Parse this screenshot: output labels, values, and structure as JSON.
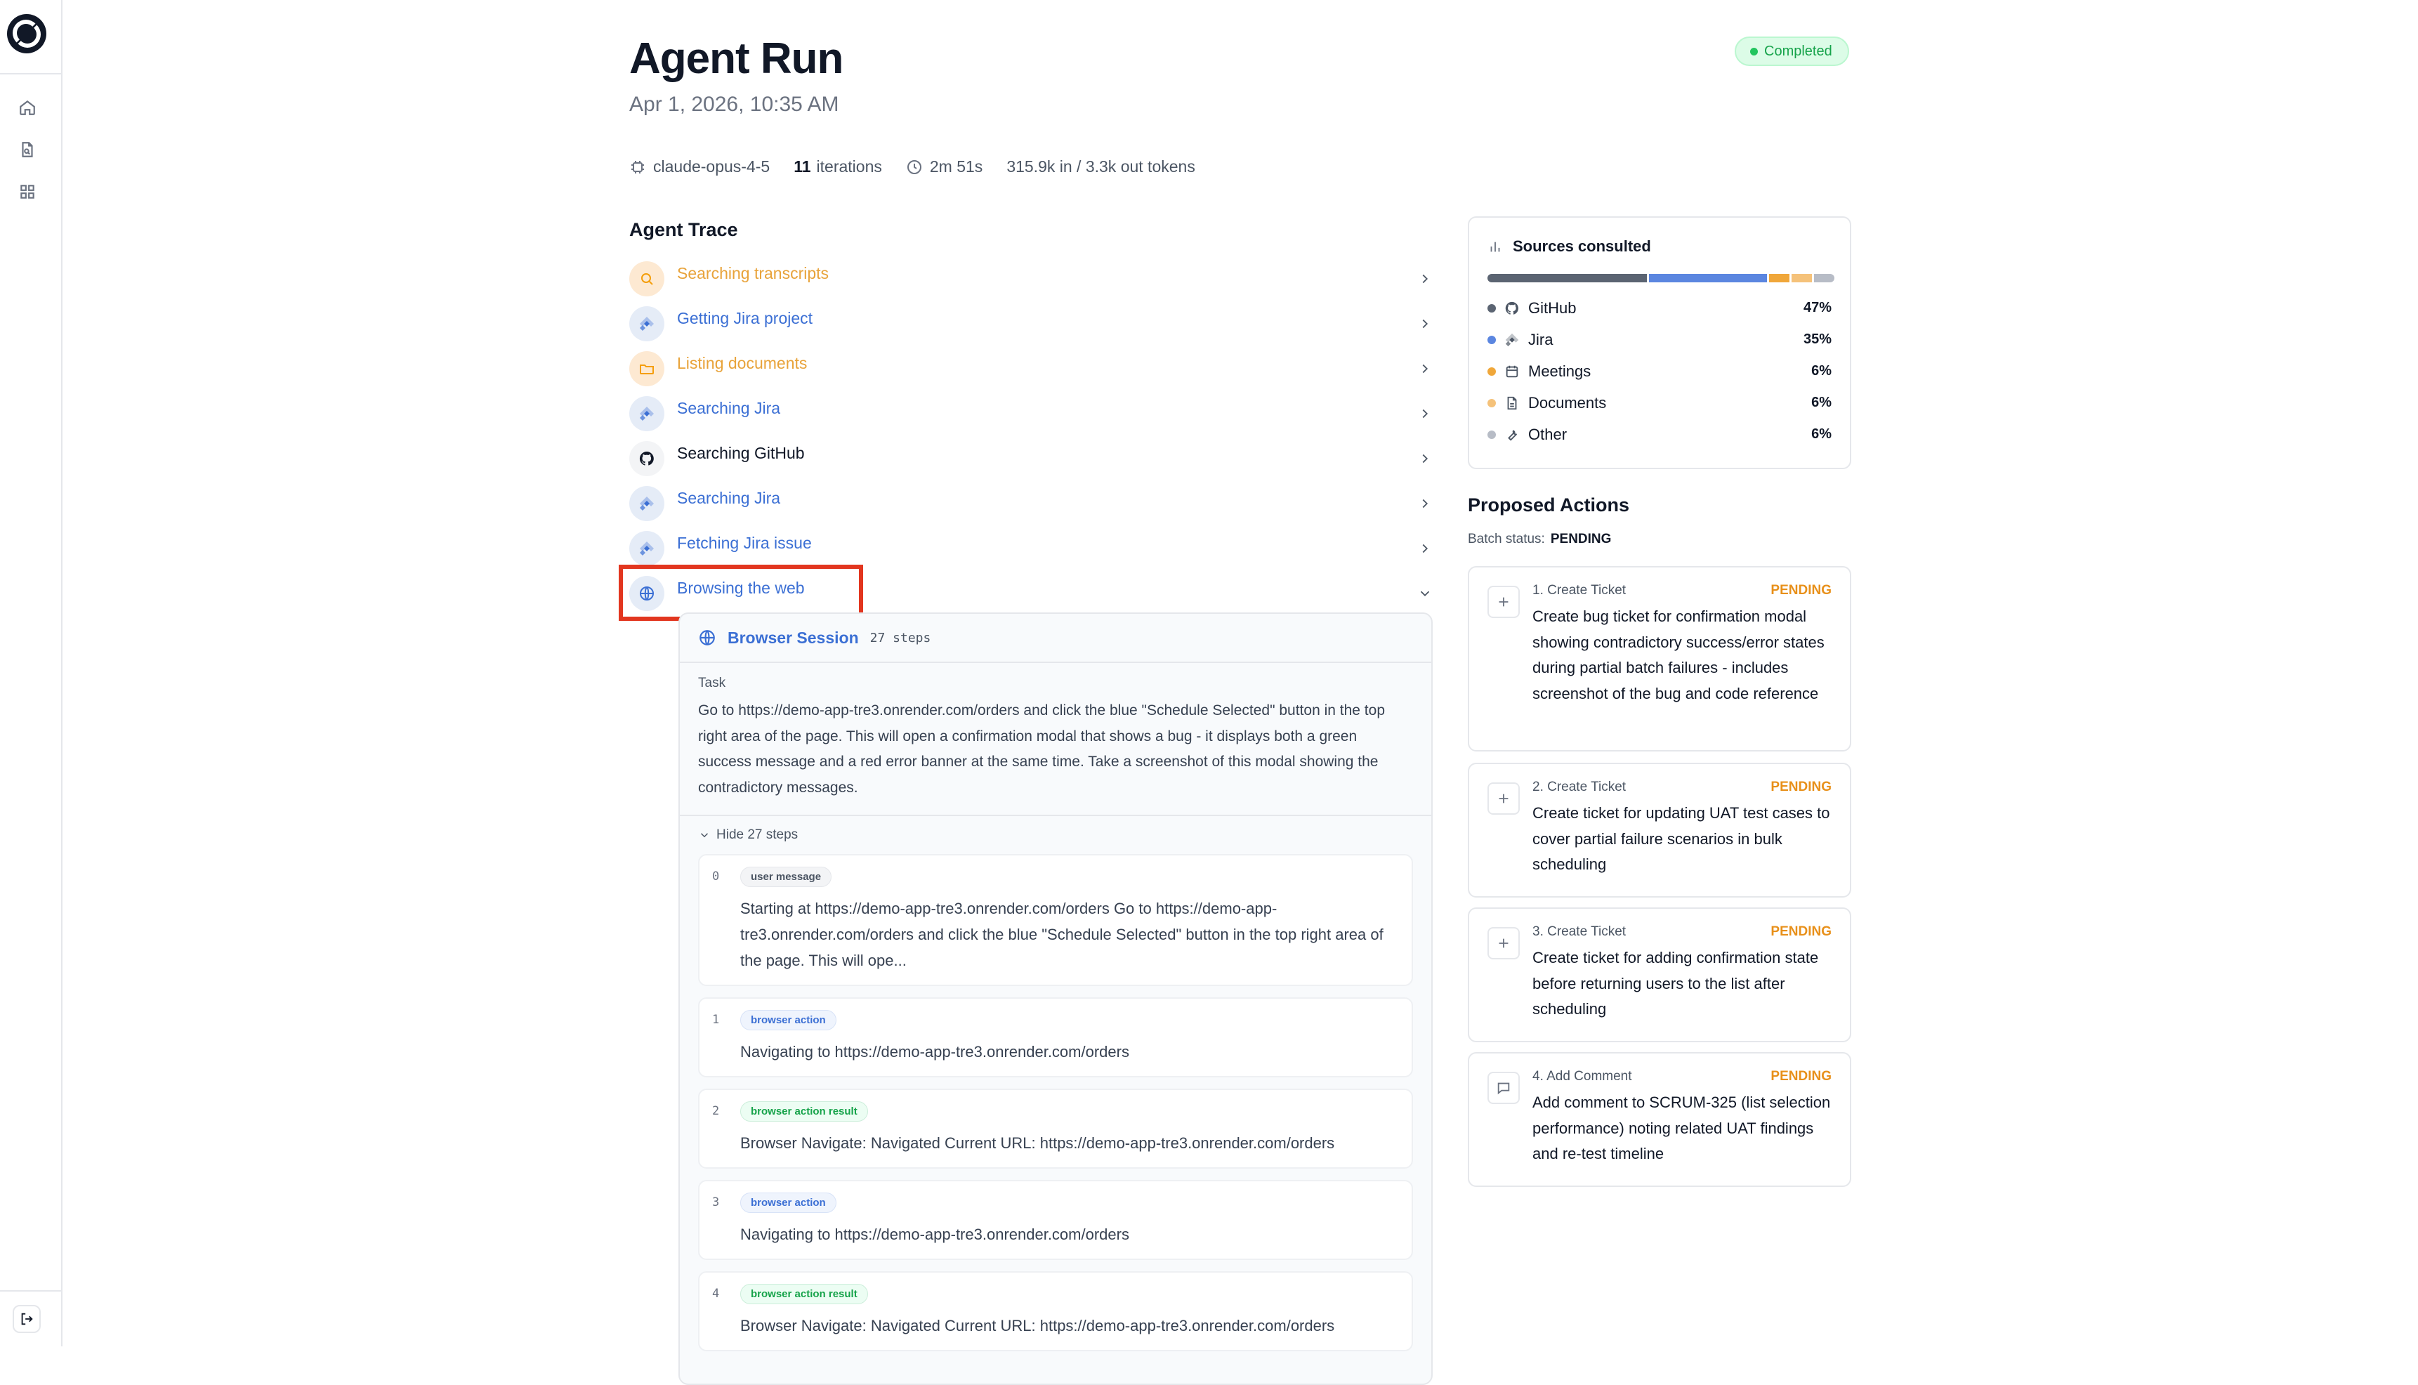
{
  "header": {
    "title": "Agent Run",
    "date": "Apr 1, 2026, 10:35 AM",
    "status_badge": "Completed"
  },
  "meta": {
    "model": "claude-opus-4-5",
    "iterations_count": "11",
    "iterations_label": "iterations",
    "duration": "2m 51s",
    "tokens": "315.9k in / 3.3k out tokens"
  },
  "trace": {
    "title": "Agent Trace",
    "items": [
      {
        "label": "Searching transcripts",
        "icon": "search-icon",
        "color": "#e8a33a"
      },
      {
        "label": "Getting Jira project",
        "icon": "jira-icon",
        "color": "#3b6fd4"
      },
      {
        "label": "Listing documents",
        "icon": "folder-icon",
        "color": "#e8a33a"
      },
      {
        "label": "Searching Jira",
        "icon": "jira-icon",
        "color": "#3b6fd4"
      },
      {
        "label": "Searching GitHub",
        "icon": "github-icon",
        "color": "#111827"
      },
      {
        "label": "Searching Jira",
        "icon": "jira-icon",
        "color": "#3b6fd4"
      },
      {
        "label": "Fetching Jira issue",
        "icon": "jira-icon",
        "color": "#3b6fd4"
      },
      {
        "label": "Browsing the web",
        "icon": "globe-icon",
        "color": "#3b6fd4"
      }
    ]
  },
  "session": {
    "title": "Browser Session",
    "steps_count": "27 steps",
    "task_label": "Task",
    "task_text": "Go to https://demo-app-tre3.onrender.com/orders and click the blue \"Schedule Selected\" button in the top right area of the page. This will open a confirmation modal that shows a bug - it displays both a green success message and a red error banner at the same time. Take a screenshot of this modal showing the contradictory messages.",
    "hide_steps": "Hide 27 steps",
    "steps": [
      {
        "num": "0",
        "tag": "user message",
        "text": "Starting at https://demo-app-tre3.onrender.com/orders Go to https://demo-app-tre3.onrender.com/orders and click the blue \"Schedule Selected\" button in the top right area of the page. This will ope..."
      },
      {
        "num": "1",
        "tag": "browser action",
        "text": "Navigating to https://demo-app-tre3.onrender.com/orders"
      },
      {
        "num": "2",
        "tag": "browser action result",
        "text": "Browser Navigate: Navigated Current URL: https://demo-app-tre3.onrender.com/orders"
      },
      {
        "num": "3",
        "tag": "browser action",
        "text": "Navigating to https://demo-app-tre3.onrender.com/orders"
      },
      {
        "num": "4",
        "tag": "browser action result",
        "text": "Browser Navigate: Navigated Current URL: https://demo-app-tre3.onrender.com/orders"
      }
    ]
  },
  "sources": {
    "title": "Sources consulted",
    "items": [
      {
        "name": "GitHub",
        "pct": "47%",
        "value": 47,
        "color": "#5b6472",
        "icon": "github-icon"
      },
      {
        "name": "Jira",
        "pct": "35%",
        "value": 35,
        "color": "#5b86e0",
        "icon": "jira-icon"
      },
      {
        "name": "Meetings",
        "pct": "6%",
        "value": 6,
        "color": "#f0a73a",
        "icon": "calendar-icon"
      },
      {
        "name": "Documents",
        "pct": "6%",
        "value": 6,
        "color": "#f5c27a",
        "icon": "document-icon"
      },
      {
        "name": "Other",
        "pct": "6%",
        "value": 6,
        "color": "#b7bcc6",
        "icon": "wrench-icon"
      }
    ]
  },
  "actions": {
    "title": "Proposed Actions",
    "batch_label": "Batch status:",
    "batch_value": "PENDING",
    "items": [
      {
        "heading": "1. Create Ticket",
        "status": "PENDING",
        "icon": "plus-icon",
        "text": "Create bug ticket for confirmation modal showing contradictory success/error states during partial batch failures - includes screenshot of the bug and code reference"
      },
      {
        "heading": "2. Create Ticket",
        "status": "PENDING",
        "icon": "plus-icon",
        "text": "Create ticket for updating UAT test cases to cover partial failure scenarios in bulk scheduling"
      },
      {
        "heading": "3. Create Ticket",
        "status": "PENDING",
        "icon": "plus-icon",
        "text": "Create ticket for adding confirmation state before returning users to the list after scheduling"
      },
      {
        "heading": "4. Add Comment",
        "status": "PENDING",
        "icon": "comment-icon",
        "text": "Add comment to SCRUM-325 (list selection performance) noting related UAT findings and re-test timeline"
      }
    ]
  }
}
